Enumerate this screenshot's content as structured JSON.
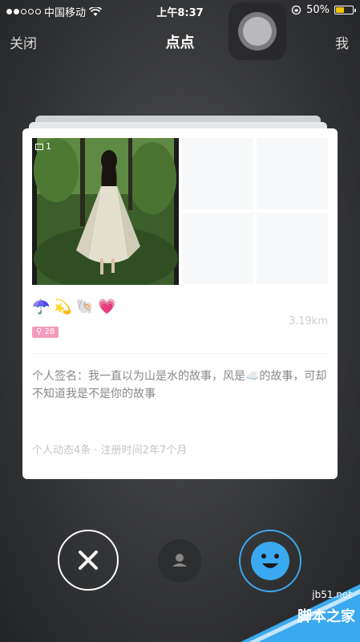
{
  "status_bar": {
    "carrier": "中国移动",
    "time": "上午8:37",
    "battery_percent": "50%",
    "battery_level": 0.5,
    "signal_dots_filled": 2,
    "signal_dots_total": 5
  },
  "nav": {
    "close_label": "关闭",
    "title": "点点",
    "me_label": "我"
  },
  "card": {
    "photo_count": "1",
    "emojis": [
      "☂️",
      "💫",
      "🐚",
      "💗"
    ],
    "level_badge": "28",
    "distance": "3.19km",
    "signature": "个人签名：我一直以为山是水的故事，风是☁️的故事，可却不知道我是不是你的故事",
    "meta": "个人动态4条 · 注册时间2年7个月"
  },
  "watermark": {
    "url": "jb51.net",
    "name": "脚本之家"
  },
  "colors": {
    "accent_blue": "#3aa9f0",
    "badge_pink": "#f29bbb",
    "battery_yellow": "#f5c400"
  }
}
